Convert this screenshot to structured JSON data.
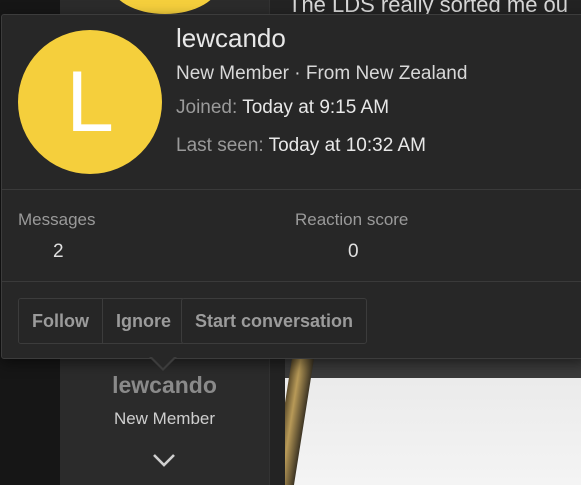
{
  "background": {
    "post_title": "The LDS really sorted me ou",
    "username": "lewcando",
    "role": "New Member"
  },
  "popup": {
    "avatar_letter": "L",
    "avatar_color": "#f5cf3c",
    "username": "lewcando",
    "user_title": "New Member · From New Zealand",
    "joined_label": "Joined:",
    "joined_value": "Today at 9:15 AM",
    "last_seen_label": "Last seen:",
    "last_seen_value": "Today at 10:32 AM",
    "stats": [
      {
        "label": "Messages",
        "value": "2"
      },
      {
        "label": "Reaction score",
        "value": "0"
      }
    ],
    "buttons": {
      "follow": "Follow",
      "ignore": "Ignore",
      "start_conversation": "Start conversation"
    }
  },
  "icons": {
    "expand": "chevron-down-icon"
  }
}
